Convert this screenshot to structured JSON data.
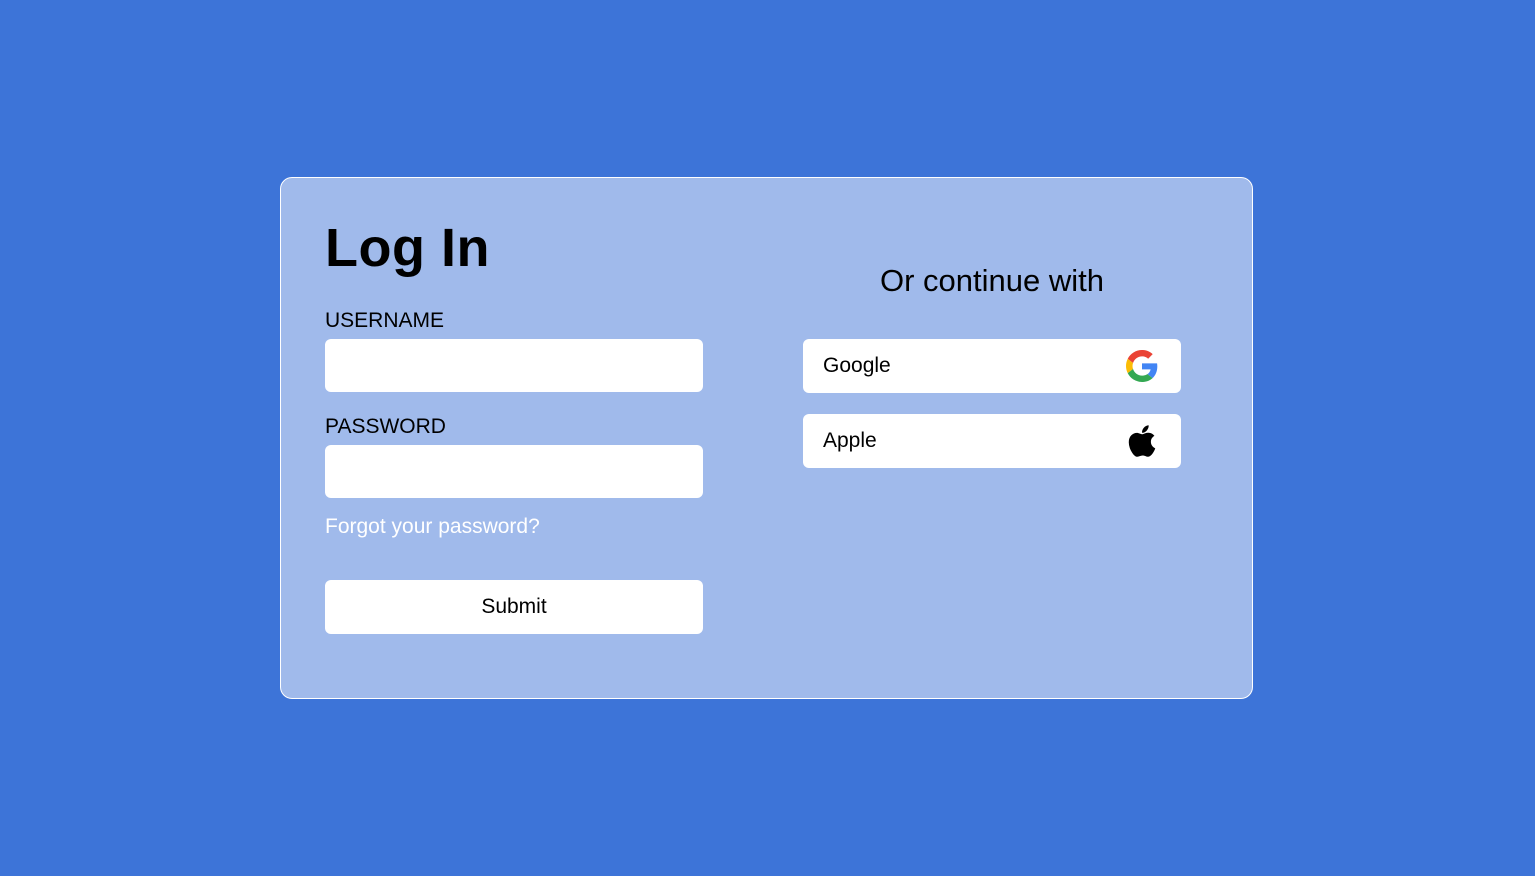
{
  "login": {
    "title": "Log In",
    "username_label": "USERNAME",
    "username_value": "",
    "password_label": "PASSWORD",
    "password_value": "",
    "forgot_link": "Forgot your password?",
    "submit_label": "Submit"
  },
  "social": {
    "heading": "Or continue with",
    "providers": [
      {
        "label": "Google",
        "icon": "google-icon"
      },
      {
        "label": "Apple",
        "icon": "apple-icon"
      }
    ]
  },
  "colors": {
    "background": "#3d74d8",
    "card": "#a0baeb",
    "forgot_link": "#ffffff"
  }
}
